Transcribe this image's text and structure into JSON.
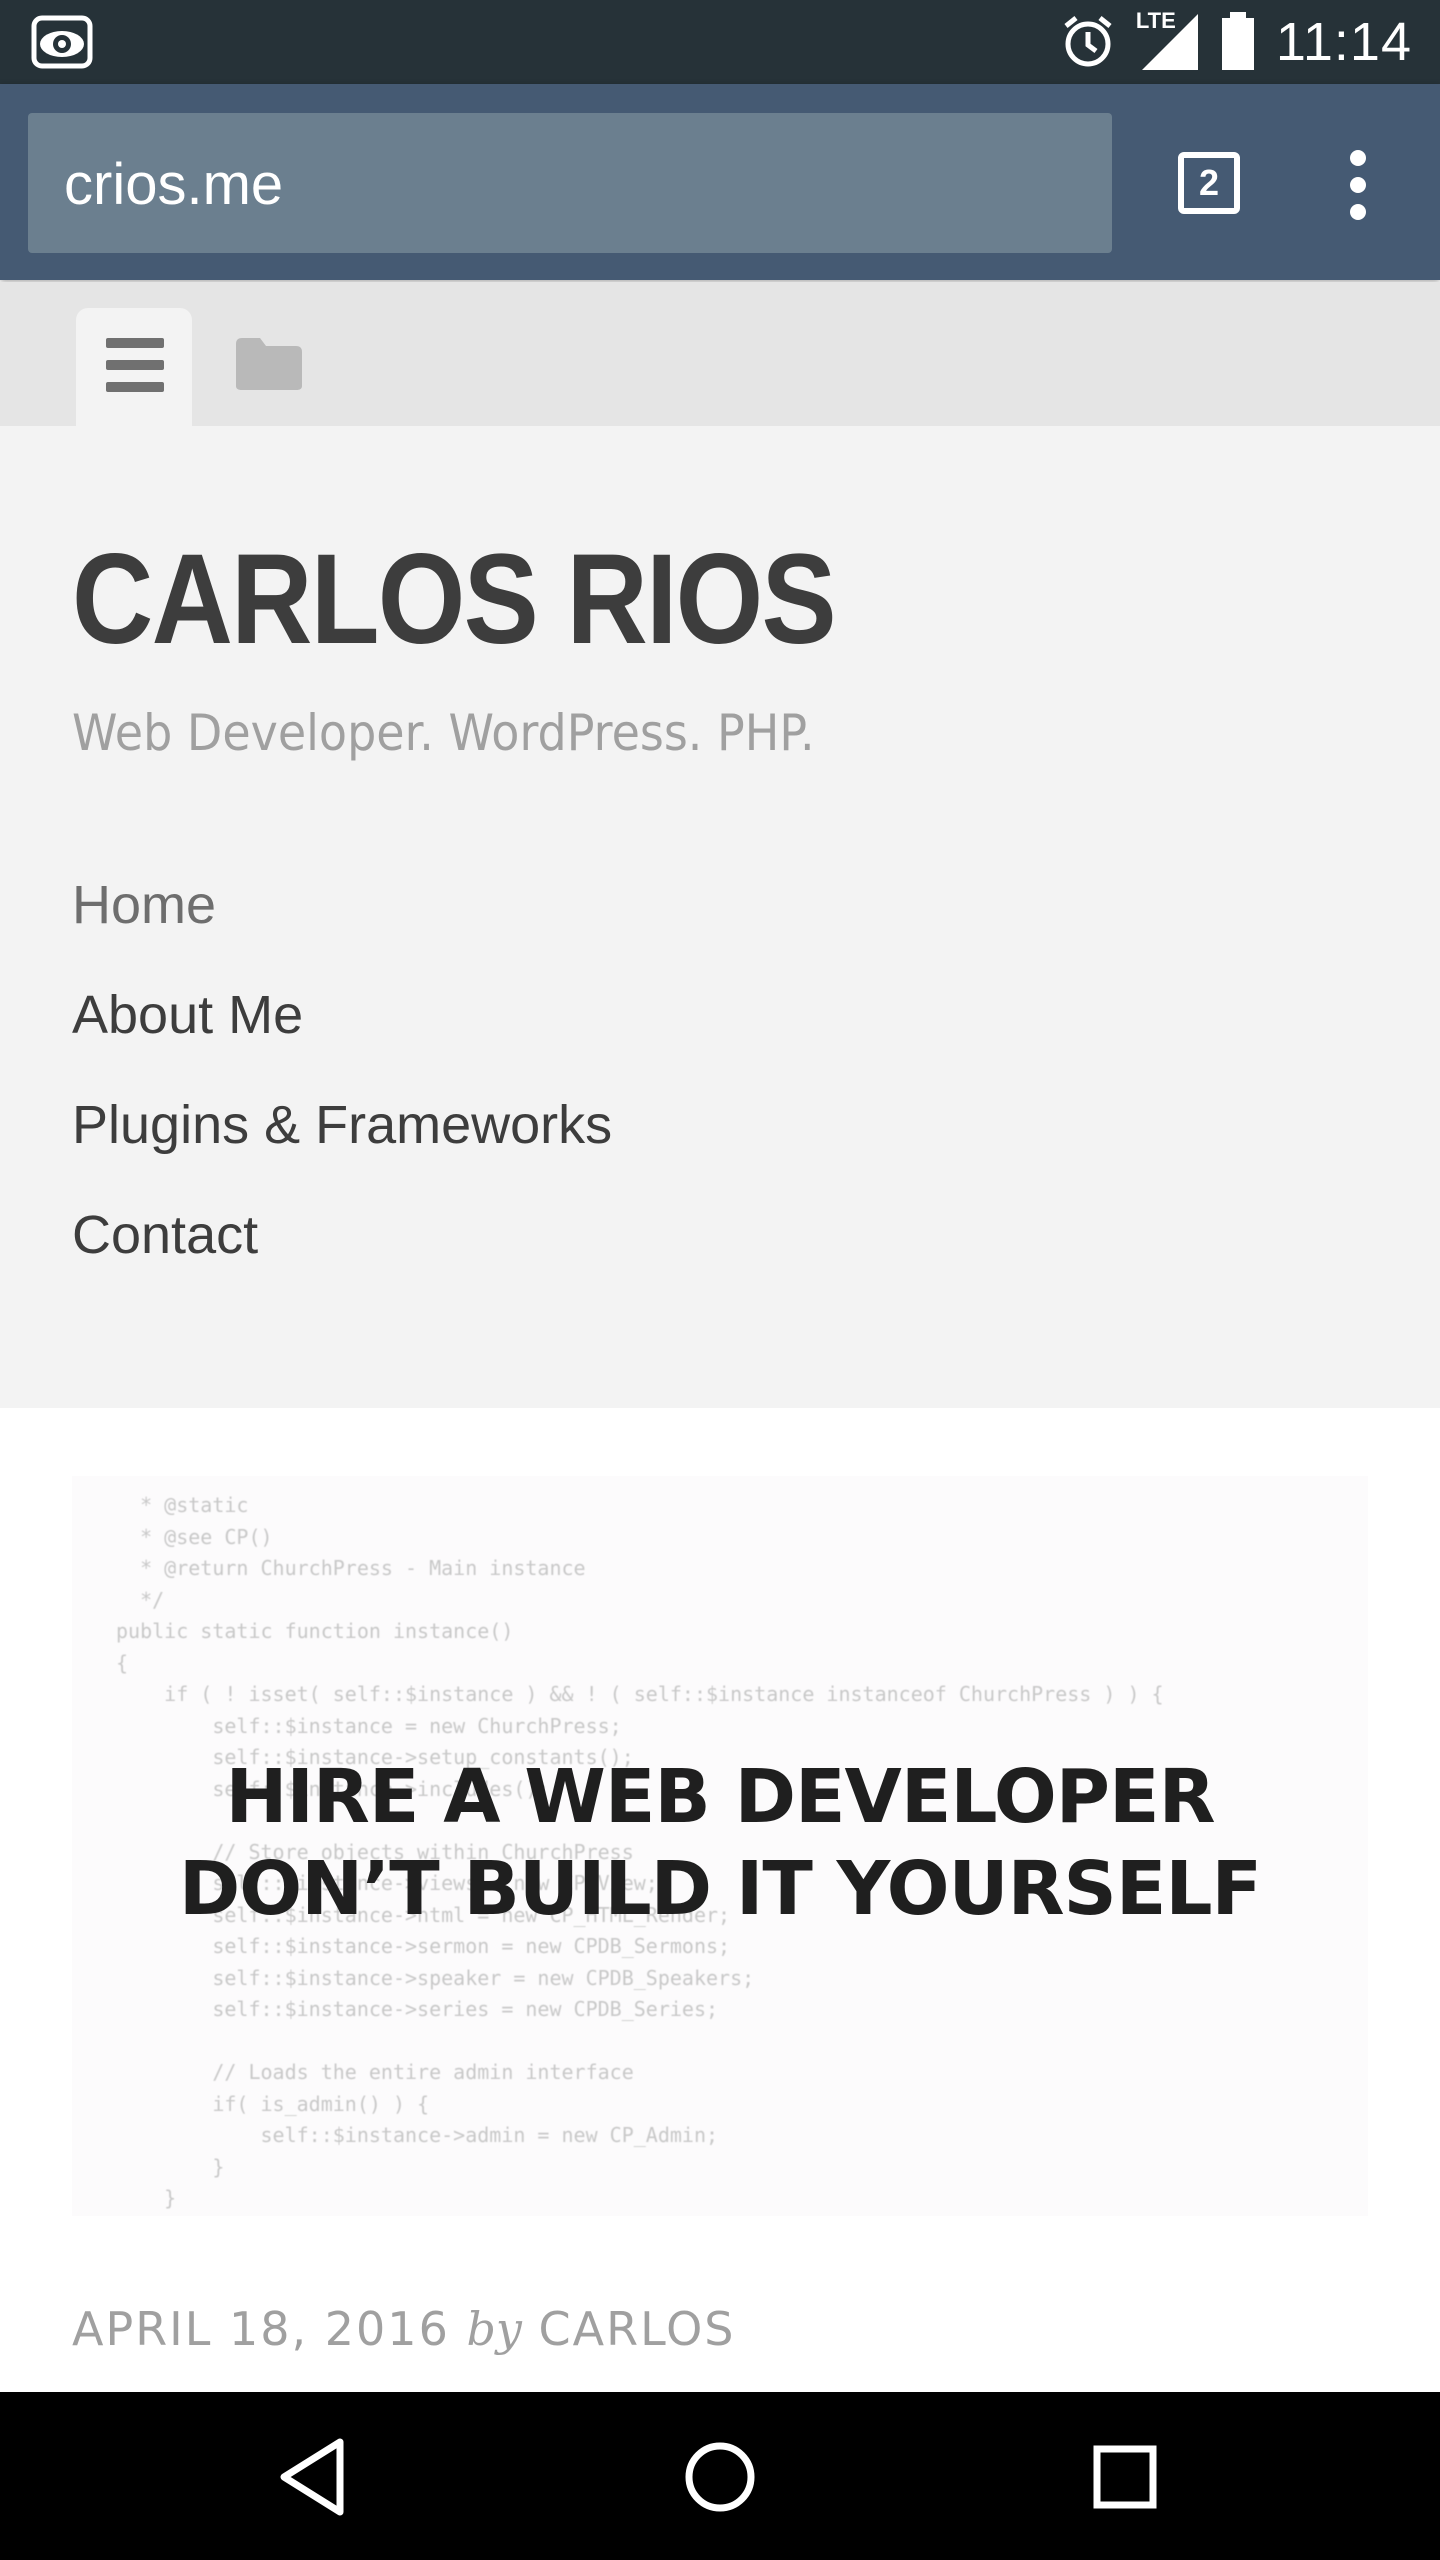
{
  "status_bar": {
    "time": "11:14",
    "network": "LTE",
    "icons": [
      "eye-icon",
      "alarm-icon",
      "signal-icon",
      "battery-icon"
    ]
  },
  "browser": {
    "url": "crios.me",
    "tab_count": "2",
    "icons": [
      "tab-switcher-icon",
      "overflow-menu-icon"
    ]
  },
  "tabstrip": {
    "icons": [
      "hamburger-menu-icon",
      "folder-icon"
    ]
  },
  "site": {
    "title": "CARLOS RIOS",
    "tagline": "Web Developer. WordPress. PHP."
  },
  "nav": {
    "items": [
      {
        "label": "Home"
      },
      {
        "label": "About Me"
      },
      {
        "label": "Plugins & Frameworks"
      },
      {
        "label": "Contact"
      }
    ]
  },
  "hero": {
    "line1": "HIRE A WEB DEVELOPER",
    "line2": "DON’T BUILD IT YOURSELF",
    "code_lines": [
      "  * @static",
      "  * @see CP()",
      "  * @return ChurchPress - Main instance",
      "  */",
      "public static function instance()",
      "{",
      "    if ( ! isset( self::$instance ) && ! ( self::$instance instanceof ChurchPress ) ) {",
      "        self::$instance = new ChurchPress;",
      "        self::$instance->setup_constants();",
      "        self::$instance->includes();",
      "",
      "        // Store objects within ChurchPress",
      "        self::$instance->views = new CP_View;",
      "        self::$instance->html = new CP_HTML_Render;",
      "        self::$instance->sermon = new CPDB_Sermons;",
      "        self::$instance->speaker = new CPDB_Speakers;",
      "        self::$instance->series = new CPDB_Series;",
      "",
      "        // Loads the entire admin interface",
      "        if( is_admin() ) {",
      "            self::$instance->admin = new CP_Admin;",
      "        }",
      "    }"
    ]
  },
  "post_meta": {
    "date": "APRIL 18, 2016",
    "by": "by",
    "author": "CARLOS"
  },
  "system_nav": {
    "icons": [
      "back-icon",
      "home-icon",
      "recents-icon"
    ]
  }
}
